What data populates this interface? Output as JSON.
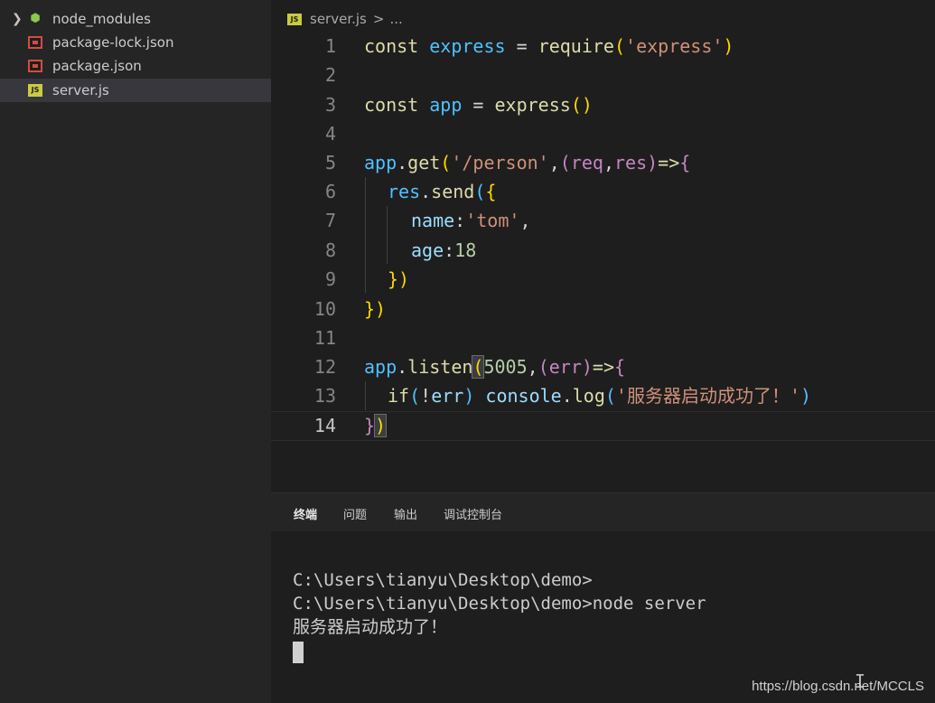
{
  "sidebar": {
    "items": [
      {
        "label": "node_modules",
        "icon": "node-modules-folder-icon",
        "expandable": true
      },
      {
        "label": "package-lock.json",
        "icon": "json-file-icon"
      },
      {
        "label": "package.json",
        "icon": "json-file-icon"
      },
      {
        "label": "server.js",
        "icon": "js-file-icon",
        "selected": true
      }
    ]
  },
  "editor": {
    "breadcrumb": {
      "icon_text": "JS",
      "file": "server.js",
      "separator": ">",
      "rest": "..."
    },
    "active_line": 14,
    "line_numbers": [
      "1",
      "2",
      "3",
      "4",
      "5",
      "6",
      "7",
      "8",
      "9",
      "10",
      "11",
      "12",
      "13",
      "14"
    ],
    "code": {
      "l1": {
        "kw": "const",
        "name": "express",
        "eq": " = ",
        "fn": "require",
        "open": "(",
        "str": "'express'",
        "close": ")"
      },
      "l3": {
        "kw": "const",
        "name": "app",
        "eq": " = ",
        "fn": "express",
        "parens": "()"
      },
      "l5": {
        "obj": "app",
        "dot": ".",
        "fn": "get",
        "open": "(",
        "str": "'/person'",
        "comma": ",",
        "p_open": "(",
        "p1": "req",
        "p_comma": ",",
        "p2": "res",
        "p_close": ")",
        "arrow": "=>",
        "brace": "{"
      },
      "l6": {
        "obj": "res",
        "dot": ".",
        "fn": "send",
        "open": "(",
        "brace": "{"
      },
      "l7": {
        "prop": "name",
        "colon": ":",
        "str": "'tom'",
        "comma": ","
      },
      "l8": {
        "prop": "age",
        "colon": ":",
        "num": "18"
      },
      "l9": {
        "text": "})"
      },
      "l10": {
        "text": "})"
      },
      "l12": {
        "obj": "app",
        "dot": ".",
        "fn": "listen",
        "open": "(",
        "num": "5005",
        "comma": ",",
        "p_open": "(",
        "p1": "err",
        "p_close": ")",
        "arrow": "=>",
        "brace": "{"
      },
      "l13": {
        "kw": "if",
        "open": "(",
        "not": "!",
        "var": "err",
        "close": ")",
        "space": " ",
        "obj": "console",
        "dot": ".",
        "fn": "log",
        "open2": "(",
        "str": "'服务器启动成功了！'",
        "close2": ")"
      },
      "l14": {
        "brace": "}",
        "paren": ")"
      }
    }
  },
  "panel": {
    "tabs": [
      "终端",
      "问题",
      "输出",
      "调试控制台"
    ],
    "active_tab": "终端",
    "terminal_lines": [
      "C:\\Users\\tianyu\\Desktop\\demo>",
      "C:\\Users\\tianyu\\Desktop\\demo>node server",
      "服务器启动成功了！"
    ],
    "mouse_cursor": "I"
  },
  "watermark": "https://blog.csdn.net/MCCLS",
  "colors": {
    "sidebar_bg": "#252526",
    "editor_bg": "#1e1e1e",
    "keyword": "#dcdcaa",
    "variable": "#4fc1ff",
    "string": "#ce9178",
    "number": "#b5cea8",
    "property": "#9cdcfe"
  }
}
